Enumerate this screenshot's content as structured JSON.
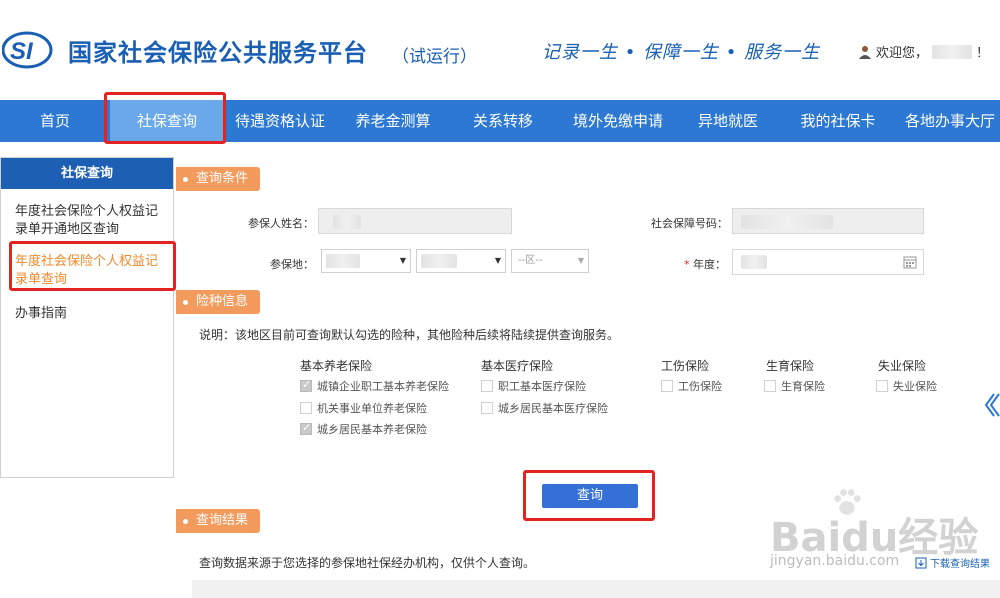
{
  "header": {
    "logo_text": "SI",
    "title": "国家社会保险公共服务平台",
    "subtitle": "（试运行）",
    "slogan": "记录一生 • 保障一生 • 服务一生",
    "welcome": "欢迎您，",
    "welcome_suffix": "！",
    "brand_color": "#1a5fb4"
  },
  "nav": {
    "items": [
      "首页",
      "社保查询",
      "待遇资格认证",
      "养老金测算",
      "关系转移",
      "境外免缴申请",
      "异地就医",
      "我的社保卡",
      "各地办事大厅"
    ],
    "active_index": 1,
    "color": "#2d78d2"
  },
  "sidebar": {
    "title": "社保查询",
    "items": [
      {
        "label": "年度社会保险个人权益记录单开通地区查询",
        "active": false
      },
      {
        "label": "年度社会保险个人权益记录单查询",
        "active": true
      },
      {
        "label": "办事指南",
        "active": false
      }
    ]
  },
  "query": {
    "section_title": "查询条件",
    "name_label": "参保人姓名：",
    "ssn_label": "社会保障号码：",
    "region_label": "参保地：",
    "district_placeholder": "--区--",
    "year_label": "年度：",
    "year_required_mark": "*"
  },
  "insurance": {
    "section_title": "险种信息",
    "note": "说明：该地区目前可查询默认勾选的险种，其他险种后续将陆续提供查询服务。",
    "groups": [
      {
        "title": "基本养老保险",
        "options": [
          {
            "label": "城镇企业职工基本养老保险",
            "checked": true
          },
          {
            "label": "机关事业单位养老保险",
            "checked": false
          },
          {
            "label": "城乡居民基本养老保险",
            "checked": true
          }
        ]
      },
      {
        "title": "基本医疗保险",
        "options": [
          {
            "label": "职工基本医疗保险",
            "checked": false
          },
          {
            "label": "城乡居民基本医疗保险",
            "checked": false
          }
        ]
      },
      {
        "title": "工伤保险",
        "options": [
          {
            "label": "工伤保险",
            "checked": false
          }
        ]
      },
      {
        "title": "生育保险",
        "options": [
          {
            "label": "生育保险",
            "checked": false
          }
        ]
      },
      {
        "title": "失业保险",
        "options": [
          {
            "label": "失业保险",
            "checked": false
          }
        ]
      }
    ]
  },
  "actions": {
    "query_button": "查询"
  },
  "results": {
    "section_title": "查询结果",
    "note": "查询数据来源于您选择的参保地社保经办机构，仅供个人查询。",
    "download_label": "下载查询结果"
  },
  "watermark": {
    "main": "Baidu经验",
    "sub": "jingyan.baidu.com"
  }
}
